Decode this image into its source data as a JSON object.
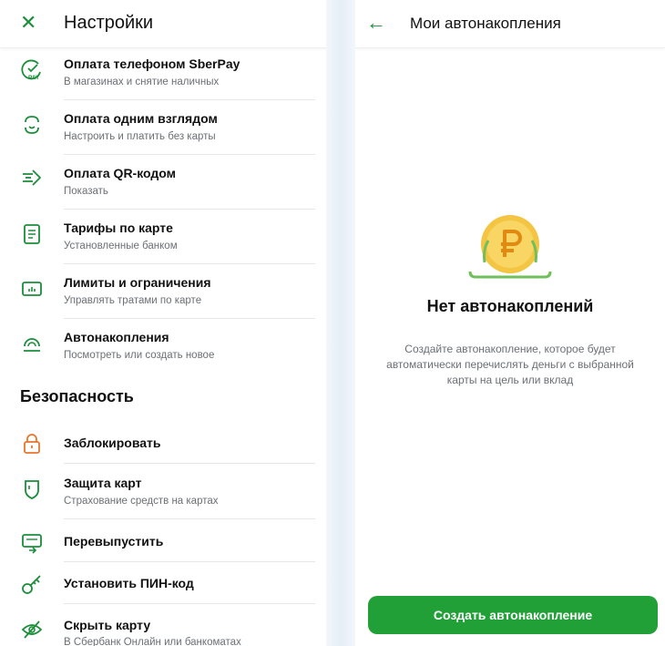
{
  "left": {
    "title": "Настройки",
    "items": [
      {
        "title": "Оплата телефоном SberPay",
        "subtitle": "В магазинах и снятие наличных",
        "icon": "sberpay-icon"
      },
      {
        "title": "Оплата одним взглядом",
        "subtitle": "Настроить и платить без карты",
        "icon": "face-pay-icon"
      },
      {
        "title": "Оплата QR-кодом",
        "subtitle": "Показать",
        "icon": "qr-pay-icon"
      },
      {
        "title": "Тарифы по карте",
        "subtitle": "Установленные банком",
        "icon": "tariff-document-icon"
      },
      {
        "title": "Лимиты и ограничения",
        "subtitle": "Управлять тратами по карте",
        "icon": "limits-icon"
      },
      {
        "title": "Автонакопления",
        "subtitle": "Посмотреть или создать новое",
        "icon": "auto-savings-icon"
      }
    ],
    "security": {
      "title": "Безопасность",
      "items": [
        {
          "title": "Заблокировать",
          "subtitle": "",
          "icon": "lock-icon"
        },
        {
          "title": "Защита карт",
          "subtitle": "Страхование средств на картах",
          "icon": "shield-icon"
        },
        {
          "title": "Перевыпустить",
          "subtitle": "",
          "icon": "reissue-card-icon"
        },
        {
          "title": "Установить ПИН-код",
          "subtitle": "",
          "icon": "key-icon"
        },
        {
          "title": "Скрыть карту",
          "subtitle": "В Сбербанк Онлайн или банкоматах",
          "icon": "eye-off-icon"
        }
      ]
    }
  },
  "right": {
    "title": "Мои автонакопления",
    "empty_title": "Нет автонакоплений",
    "empty_desc": "Создайте автонакопление, которое будет автоматически перечислять деньги с выбранной карты на цель или вклад",
    "create_label": "Создать автонакопление",
    "empty_icon": "ruble-coin-icon"
  },
  "colors": {
    "accent": "#21a038",
    "icon_green": "#1a8e3a",
    "lock_orange": "#e8762b",
    "coin_gold": "#f4c542"
  }
}
